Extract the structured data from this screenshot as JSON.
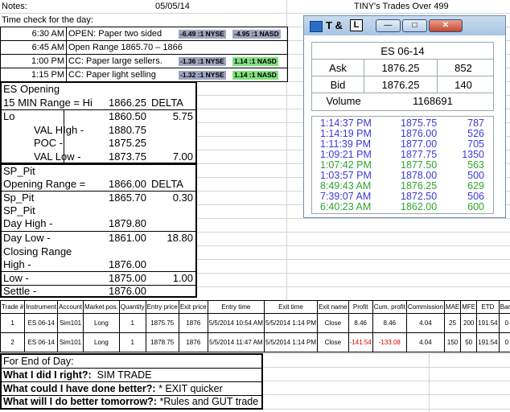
{
  "header": {
    "notes_label": "Notes:",
    "date": "05/05/14",
    "title": "TINY's Trades Over 499"
  },
  "time_check": {
    "label": "Time check for the day:",
    "rows": [
      {
        "time": "6:30 AM",
        "text": "OPEN: Paper two sided",
        "badge1": "-6.49 :1 NYSE",
        "badge2": "-4.95 :1 NASD"
      },
      {
        "time": "6:45 AM",
        "text": "Open Range 1865.70 – 1866",
        "badge1": "",
        "badge2": ""
      },
      {
        "time": "1:00 PM",
        "text": "CC: Paper large sellers.",
        "badge1": "-1.36 :1 NYSE",
        "badge2": "1.14 :1 NASD"
      },
      {
        "time": "1:15 PM",
        "text": "CC: Paper light selling",
        "badge1": "-1.32 :1 NYSE",
        "badge2": "1.14 :1 NASD"
      }
    ]
  },
  "es_opening": {
    "title": "ES Opening",
    "rows": [
      {
        "label": "15 MIN Range = Hi",
        "value": "1866.25",
        "extra": "DELTA"
      },
      {
        "label": "Lo",
        "value": "1860.50",
        "extra": "5.75"
      },
      {
        "label": "VAL HIgh  -",
        "value": "1880.75",
        "extra": ""
      },
      {
        "label": "POC   -",
        "value": "1875.25",
        "extra": ""
      },
      {
        "label": "VAL Low   -",
        "value": "1873.75",
        "extra": "7.00"
      }
    ]
  },
  "sp_pit": {
    "title": "SP_Pit",
    "rows": [
      {
        "label": "Opening Range =",
        "value": "1866.00",
        "extra": "DELTA"
      },
      {
        "label": "Sp_Pit",
        "value": "1865.70",
        "extra": "0.30"
      },
      {
        "label": "SP_Pit",
        "value": "",
        "extra": ""
      },
      {
        "label": "Day High -",
        "value": "1879.80",
        "extra": ""
      },
      {
        "label": "Day Low -",
        "value": "1861.00",
        "extra": "18.80"
      },
      {
        "label": "Closing Range",
        "value": "",
        "extra": ""
      },
      {
        "label": "High -",
        "value": "1876.00",
        "extra": ""
      },
      {
        "label": "Low -",
        "value": "1875.00",
        "extra": "1.00"
      },
      {
        "label": "Settle -",
        "value": "1876.00",
        "extra": ""
      }
    ]
  },
  "ts_window": {
    "title": "T &",
    "symbol": "ES 06-14",
    "ask_label": "Ask",
    "ask": "1876.25",
    "ask_size": "852",
    "bid_label": "Bid",
    "bid": "1876.25",
    "bid_size": "140",
    "volume_label": "Volume",
    "volume": "1168691",
    "prints": [
      {
        "time": "1:14:37 PM",
        "price": "1875.75",
        "size": "787",
        "color": "#3a3ad8"
      },
      {
        "time": "1:14:19 PM",
        "price": "1876.00",
        "size": "526",
        "color": "#3a3ad8"
      },
      {
        "time": "1:11:39 PM",
        "price": "1877.00",
        "size": "705",
        "color": "#3a3ad8"
      },
      {
        "time": "1:09:21 PM",
        "price": "1877.75",
        "size": "1350",
        "color": "#3a3ad8"
      },
      {
        "time": "1:07:42 PM",
        "price": "1877.50",
        "size": "563",
        "color": "#2fa52f"
      },
      {
        "time": "1:03:57 PM",
        "price": "1878.00",
        "size": "500",
        "color": "#3a3ad8"
      },
      {
        "time": "8:49:43 AM",
        "price": "1876.25",
        "size": "629",
        "color": "#2fa52f"
      },
      {
        "time": "7:39:07 AM",
        "price": "1872.50",
        "size": "506",
        "color": "#3a3ad8"
      },
      {
        "time": "6:40:23 AM",
        "price": "1862.00",
        "size": "600",
        "color": "#2fa52f"
      }
    ]
  },
  "trades_table": {
    "headers": [
      "Trade #",
      "Instrument",
      "Account",
      "Market pos.",
      "Quantity",
      "Entry price",
      "Exit price",
      "Entry time",
      "Exit time",
      "Exit name",
      "Profit",
      "Cum. profit",
      "Commission",
      "MAE",
      "MFE",
      "ETD",
      "Bars"
    ],
    "rows": [
      [
        "1",
        "ES 06-14",
        "Sim101",
        "Long",
        "1",
        "1875.75",
        "1876",
        "5/5/2014 10:54 AM",
        "5/5/2014 1:14 PM",
        "Close",
        "8.46",
        "8.46",
        "4.04",
        "25",
        "200",
        "191.54",
        "0"
      ],
      [
        "2",
        "ES 06-14",
        "Sim101",
        "Long",
        "1",
        "1878.75",
        "1876",
        "5/5/2014 11:47 AM",
        "5/5/2014 1:14 PM",
        "Close",
        "-141.54",
        "-133.08",
        "4.04",
        "150",
        "50",
        "191.54",
        "0"
      ]
    ]
  },
  "end_of_day": {
    "label": "For End of Day:",
    "q1": "What I did I right?:",
    "a1": "SIM TRADE",
    "q2": "What could I have done better?:",
    "a2": "* EXIT quicker",
    "q3": "What will I do better tomorrow?:",
    "a3": "*Rules and GUT trade"
  }
}
